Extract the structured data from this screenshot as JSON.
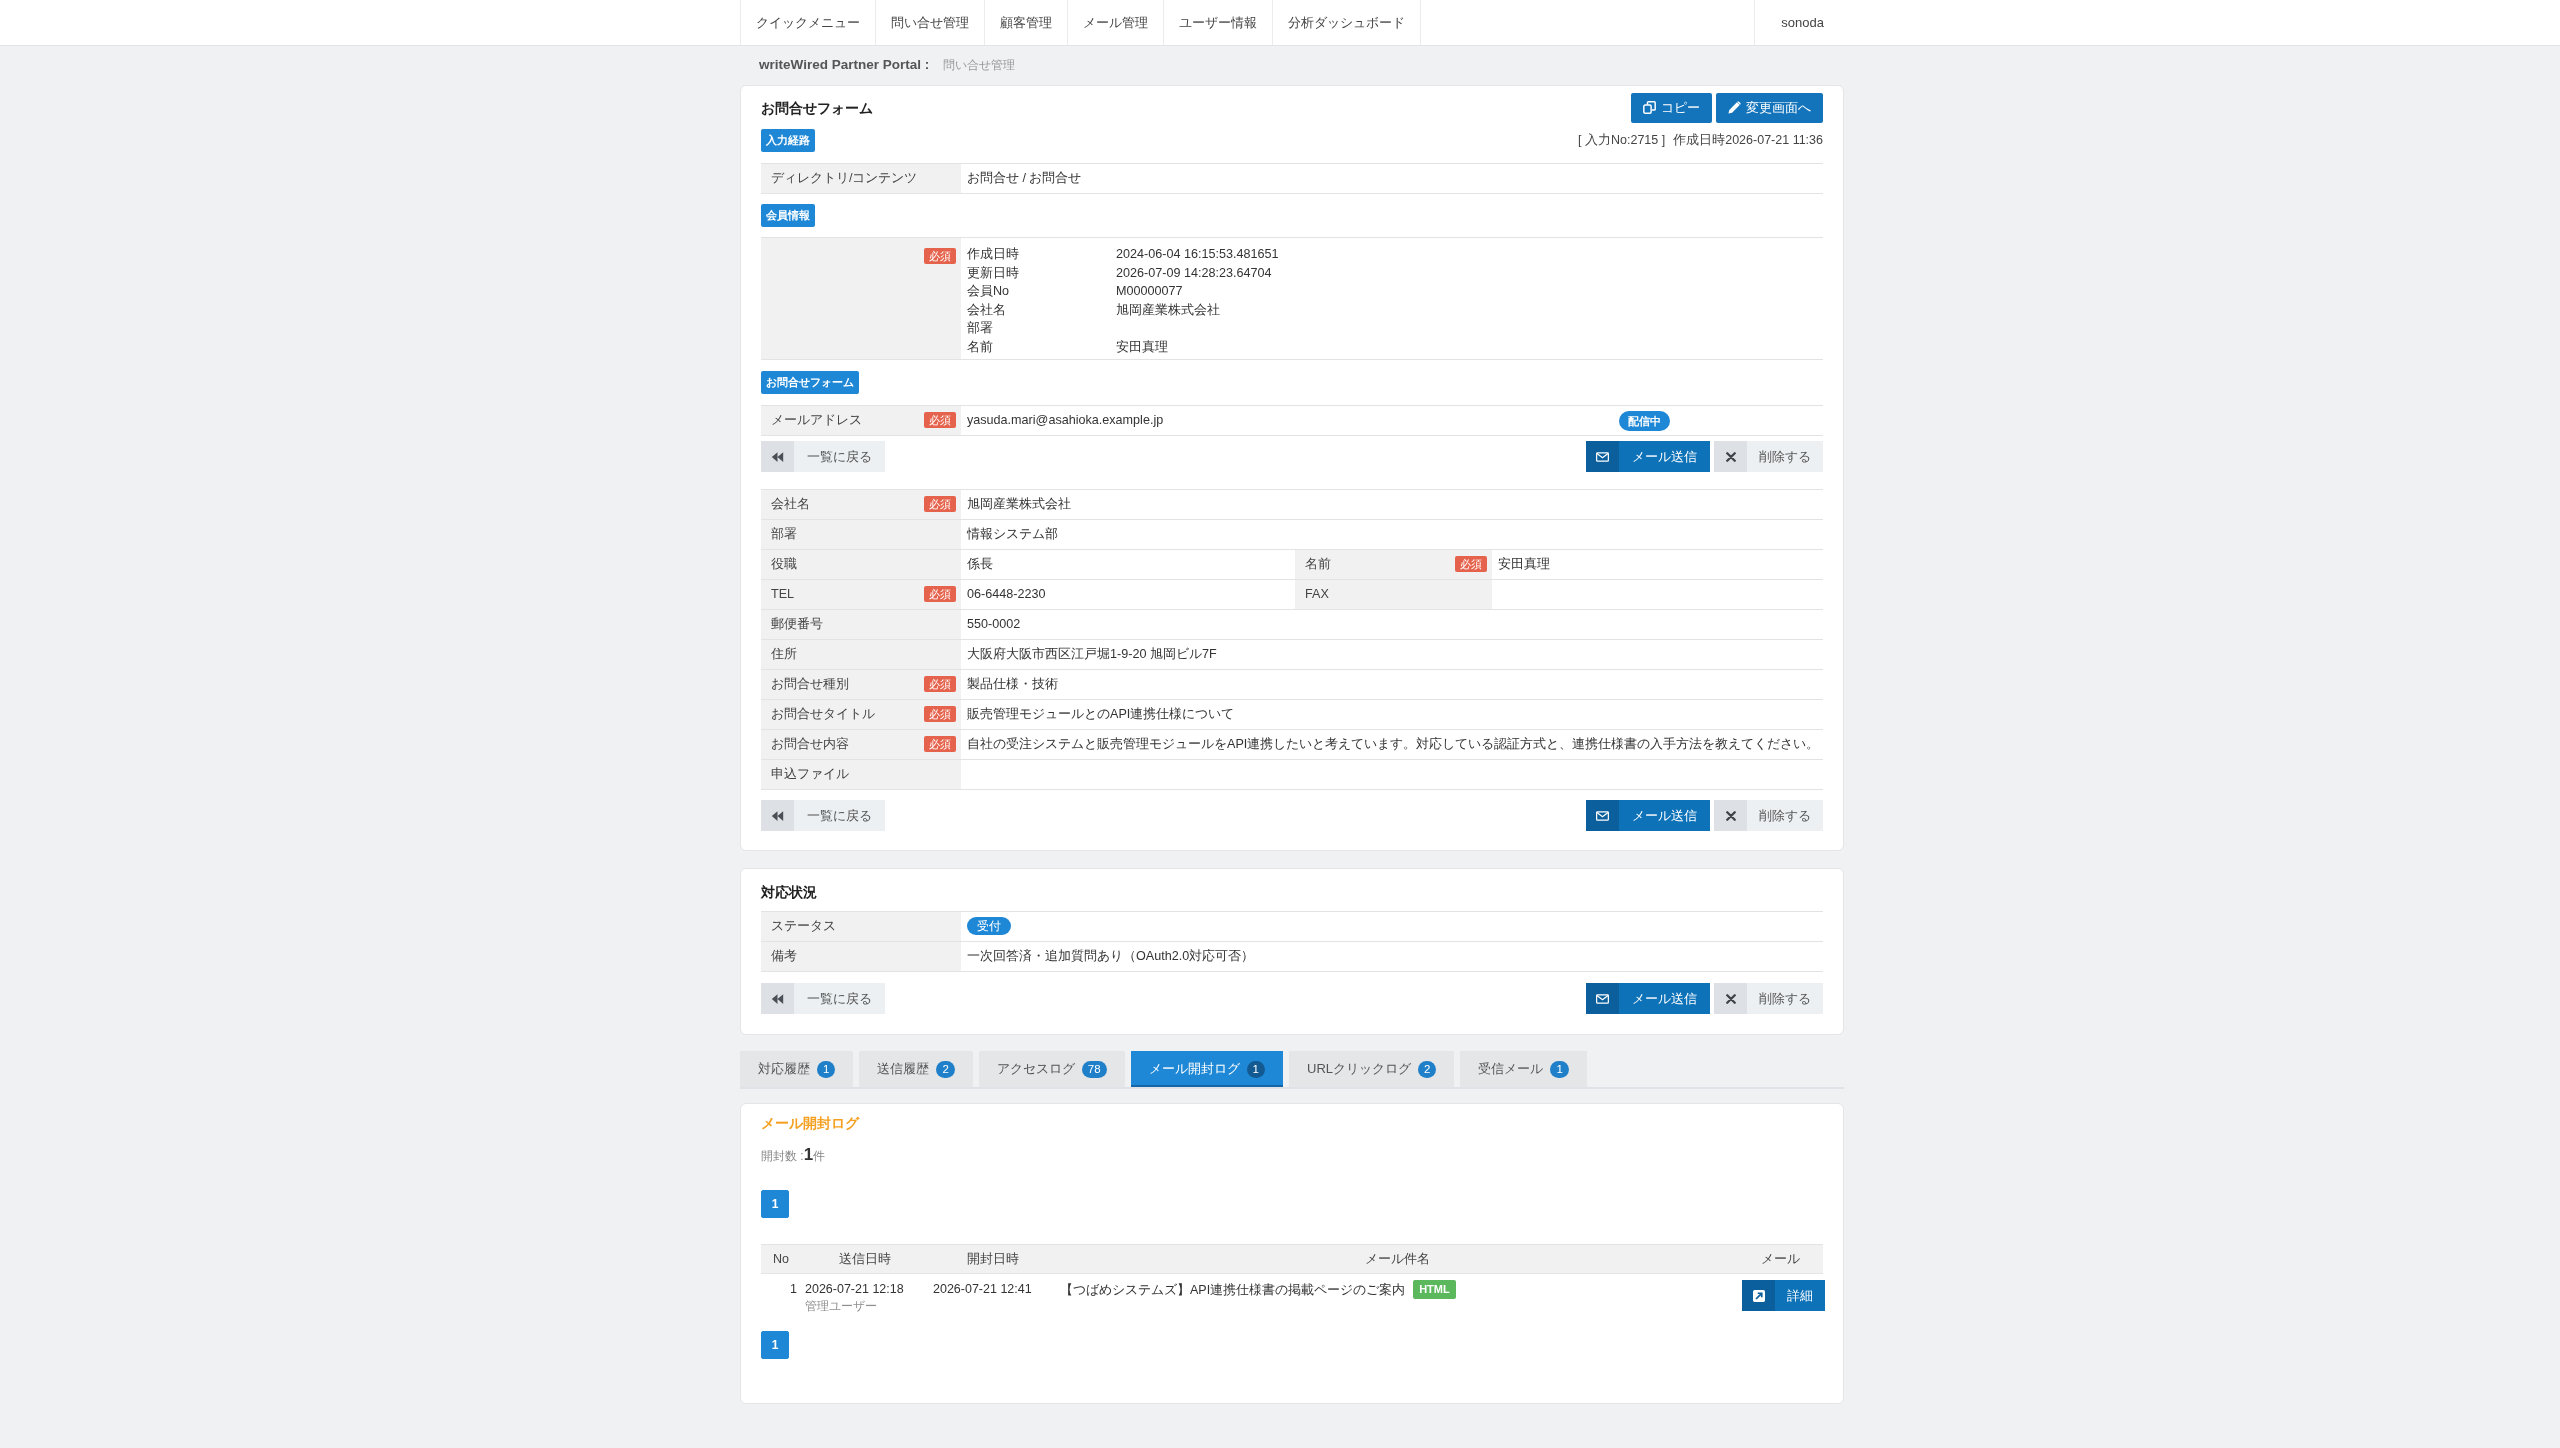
{
  "nav": {
    "items": [
      {
        "label": "クイックメニュー"
      },
      {
        "label": "問い合せ管理"
      },
      {
        "label": "顧客管理"
      },
      {
        "label": "メール管理"
      },
      {
        "label": "ユーザー情報"
      },
      {
        "label": "分析ダッシュボード"
      }
    ],
    "user": "sonoda"
  },
  "breadcrumb": {
    "site": "writeWired Partner Portal :",
    "current": "問い合せ管理"
  },
  "inquiry_form": {
    "title": "お問合せフォーム",
    "header_buttons": [
      {
        "kind": "copy",
        "label": "コピー"
      },
      {
        "kind": "edit",
        "label": "変更画面へ"
      }
    ],
    "route": {
      "badge": "入力経路",
      "entry_no": "[ 入力No:2715 ]",
      "created": "作成日時2026-07-21 11:36",
      "rows": [
        {
          "label": "ディレクトリ/コンテンツ",
          "value": "お問合せ / お問合せ"
        }
      ]
    },
    "member": {
      "badge": "会員情報",
      "required": "必須",
      "fields": [
        {
          "label": "作成日時",
          "value": "2024-06-04 16:15:53.481651"
        },
        {
          "label": "更新日時",
          "value": "2026-07-09 14:28:23.64704"
        },
        {
          "label": "会員No",
          "value": "M00000077"
        },
        {
          "label": "会社名",
          "value": "旭岡産業株式会社"
        },
        {
          "label": "部署"
        },
        {
          "label": "名前",
          "value": "安田真理"
        }
      ]
    },
    "form": {
      "badge": "お問合せフォーム",
      "email": {
        "label": "メールアドレス",
        "required": "必須",
        "value": "yasuda.mari@asahioka.example.jp",
        "status": "配信中"
      }
    },
    "email_actions": [
      {
        "kind": "back",
        "label": "一覧に戻る"
      },
      {
        "kind": "mail",
        "label": "メール送信"
      },
      {
        "kind": "delete",
        "label": "削除する"
      }
    ],
    "fields": [
      {
        "cells": [
          {
            "label": "会社名",
            "required": "必須",
            "value": "旭岡産業株式会社"
          }
        ]
      },
      {
        "cells": [
          {
            "label": "部署",
            "value": "情報システム部"
          }
        ]
      },
      {
        "cells": [
          {
            "label": "役職",
            "value": "係長"
          },
          {
            "label": "名前",
            "required": "必須",
            "value": "安田真理"
          }
        ]
      },
      {
        "cells": [
          {
            "label": "TEL",
            "required": "必須",
            "value": "06-6448-2230"
          },
          {
            "label": "FAX"
          }
        ]
      },
      {
        "cells": [
          {
            "label": "郵便番号",
            "value": "550-0002"
          }
        ]
      },
      {
        "cells": [
          {
            "label": "住所",
            "value": "大阪府大阪市西区江戸堀1-9-20 旭岡ビル7F"
          }
        ]
      },
      {
        "cells": [
          {
            "label": "お問合せ種別",
            "required": "必須",
            "value": "製品仕様・技術"
          }
        ]
      },
      {
        "cells": [
          {
            "label": "お問合せタイトル",
            "required": "必須",
            "value": "販売管理モジュールとのAPI連携仕様について"
          }
        ]
      },
      {
        "cells": [
          {
            "label": "お問合せ内容",
            "required": "必須",
            "value": "自社の受注システムと販売管理モジュールをAPI連携したいと考えています。対応している認証方式と、連携仕様書の入手方法を教えてください。"
          }
        ]
      },
      {
        "cells": [
          {
            "label": "申込ファイル"
          }
        ]
      }
    ],
    "actions": [
      {
        "kind": "back",
        "label": "一覧に戻る"
      },
      {
        "kind": "mail",
        "label": "メール送信"
      },
      {
        "kind": "delete",
        "label": "削除する"
      }
    ]
  },
  "status_panel": {
    "title": "対応状況",
    "rows": [
      {
        "kind": "pill",
        "label": "ステータス",
        "value": "受付"
      },
      {
        "kind": "text",
        "label": "備考",
        "value": "一次回答済・追加質問あり（OAuth2.0対応可否）"
      }
    ],
    "actions": [
      {
        "kind": "back",
        "label": "一覧に戻る"
      },
      {
        "kind": "mail",
        "label": "メール送信"
      },
      {
        "kind": "delete",
        "label": "削除する"
      }
    ]
  },
  "tabs": [
    {
      "label": "対応履歴",
      "count": "1",
      "selected": false
    },
    {
      "label": "送信履歴",
      "count": "2",
      "selected": false
    },
    {
      "label": "アクセスログ",
      "count": "78",
      "selected": false
    },
    {
      "label": "メール開封ログ",
      "count": "1",
      "selected": true
    },
    {
      "label": "URLクリックログ",
      "count": "2",
      "selected": false
    },
    {
      "label": "受信メール",
      "count": "1",
      "selected": false
    }
  ],
  "open_log": {
    "title": "メール開封ログ",
    "summary": "開封数 :**1**件",
    "pagination_top": [
      {
        "label": "1",
        "selected": true
      }
    ],
    "table": {
      "columns": [
        "No",
        "送信日時",
        "開封日時",
        "メール件名",
        "メール"
      ],
      "rows": [
        {
          "no": "1",
          "sent": "2026-07-21 12:18",
          "sender": "管理ユーザー",
          "opened": "2026-07-21 12:41",
          "subject": "【つばめシステムズ】API連携仕様書の掲載ページのご案内",
          "format": "HTML",
          "action": "詳細"
        }
      ]
    },
    "pagination_bottom": [
      {
        "label": "1",
        "selected": true
      }
    ]
  }
}
